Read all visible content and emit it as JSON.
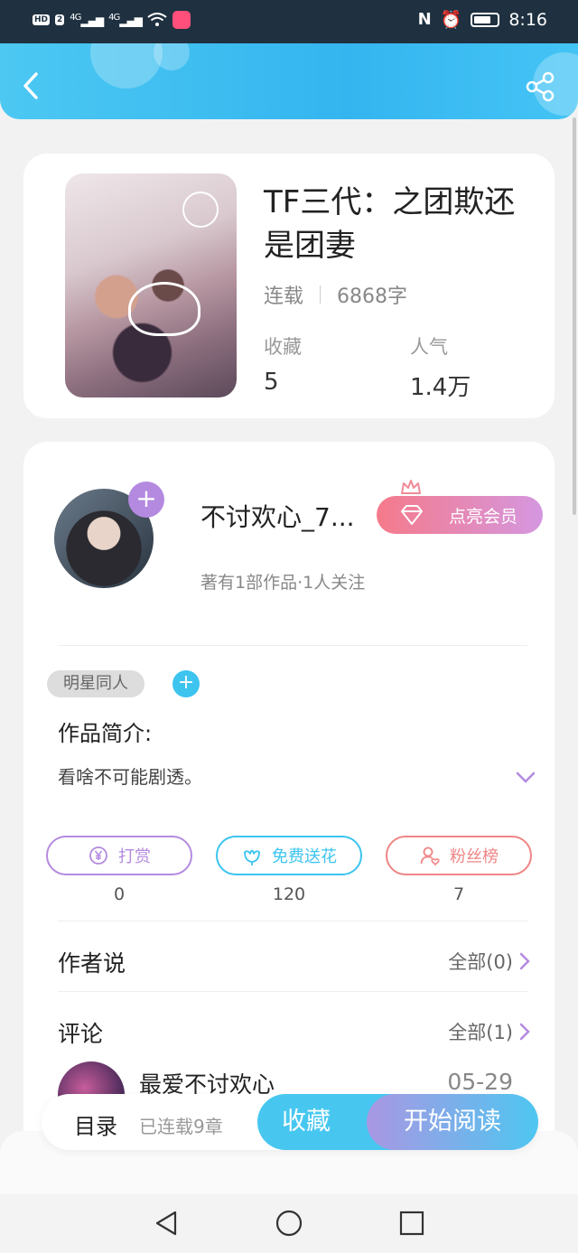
{
  "status_bar": {
    "hd_label": "HD",
    "sim_label": "2",
    "signal1": "4G",
    "signal2": "4G",
    "time": "8:16"
  },
  "header": {
    "back_icon": "chevron-left-icon",
    "share_icon": "share-icon"
  },
  "book": {
    "title": "TF三代：之团欺还是团妻",
    "status": "连载",
    "word_count": "6868字",
    "collect_label": "收藏",
    "collect_value": "5",
    "popularity_label": "人气",
    "popularity_value": "1.4万"
  },
  "author": {
    "name": "不讨欢心_7...",
    "meta": "著有1部作品·1人关注",
    "follow_plus": "+",
    "vip_button": "点亮会员"
  },
  "intro": {
    "tag": "明星同人",
    "tag_add": "+",
    "title": "作品简介:",
    "text": "看啥不可能剧透。"
  },
  "actions": [
    {
      "label": "打赏",
      "count": "0",
      "icon": "yen-coin-icon",
      "color": "#b48ae0"
    },
    {
      "label": "免费送花",
      "count": "120",
      "icon": "flower-icon",
      "color": "#3cc4ef"
    },
    {
      "label": "粉丝榜",
      "count": "7",
      "icon": "fan-user-icon",
      "color": "#ef8585"
    }
  ],
  "author_says": {
    "title": "作者说",
    "link": "全部(0)"
  },
  "comments": {
    "title": "评论",
    "link": "全部(1)",
    "first_name": "最爱不讨欢心",
    "first_date": "05-29"
  },
  "bottom_bar": {
    "toc_label": "目录",
    "toc_sub": "已连载9章",
    "fav_button": "收藏",
    "read_button": "开始阅读"
  },
  "colors": {
    "accent_blue": "#3cc4ef",
    "accent_purple": "#b48ae0",
    "accent_red": "#ef8585"
  }
}
